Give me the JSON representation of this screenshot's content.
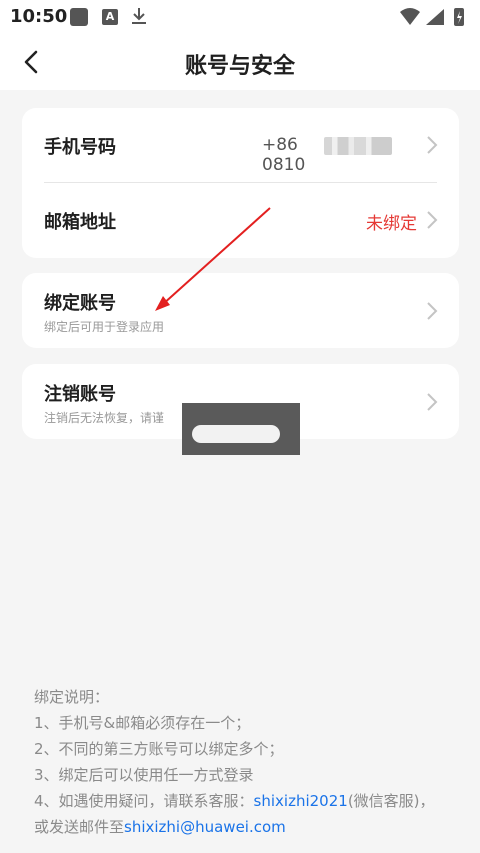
{
  "status_bar": {
    "time": "10:50",
    "left_icons": [
      "square-icon",
      "a-icon",
      "download-icon"
    ],
    "right_icons": [
      "wifi-icon",
      "signal-icon",
      "battery-icon"
    ],
    "a_icon_text": "A"
  },
  "header": {
    "title": "账号与安全",
    "back_icon": "chevron-left-icon"
  },
  "account_info": {
    "phone": {
      "label": "手机号码",
      "prefix": "+86",
      "suffix": "0810"
    },
    "email": {
      "label": "邮箱地址",
      "value": "未绑定"
    }
  },
  "bind_accounts": {
    "label": "绑定账号",
    "subtitle": "绑定后可用于登录应用"
  },
  "deactivate": {
    "label": "注销账号",
    "subtitle": "注销后无法恢复，请谨"
  },
  "notes": {
    "title": "绑定说明：",
    "line1": "1、手机号&邮箱必须存在一个；",
    "line2": "2、不同的第三方账号可以绑定多个；",
    "line3": "3、绑定后可以使用任一方式登录",
    "line4_prefix": "4、如遇使用疑问，请联系客服：",
    "line4_link": "shixizhi2021",
    "line4_suffix": "(微信客服)，",
    "line5_prefix": "或发送邮件至",
    "line5_link": "shixizhi@huawei.com"
  },
  "colors": {
    "accent_red": "#e53935",
    "link_blue": "#1a73e8",
    "annotation_arrow": "#e32020"
  }
}
